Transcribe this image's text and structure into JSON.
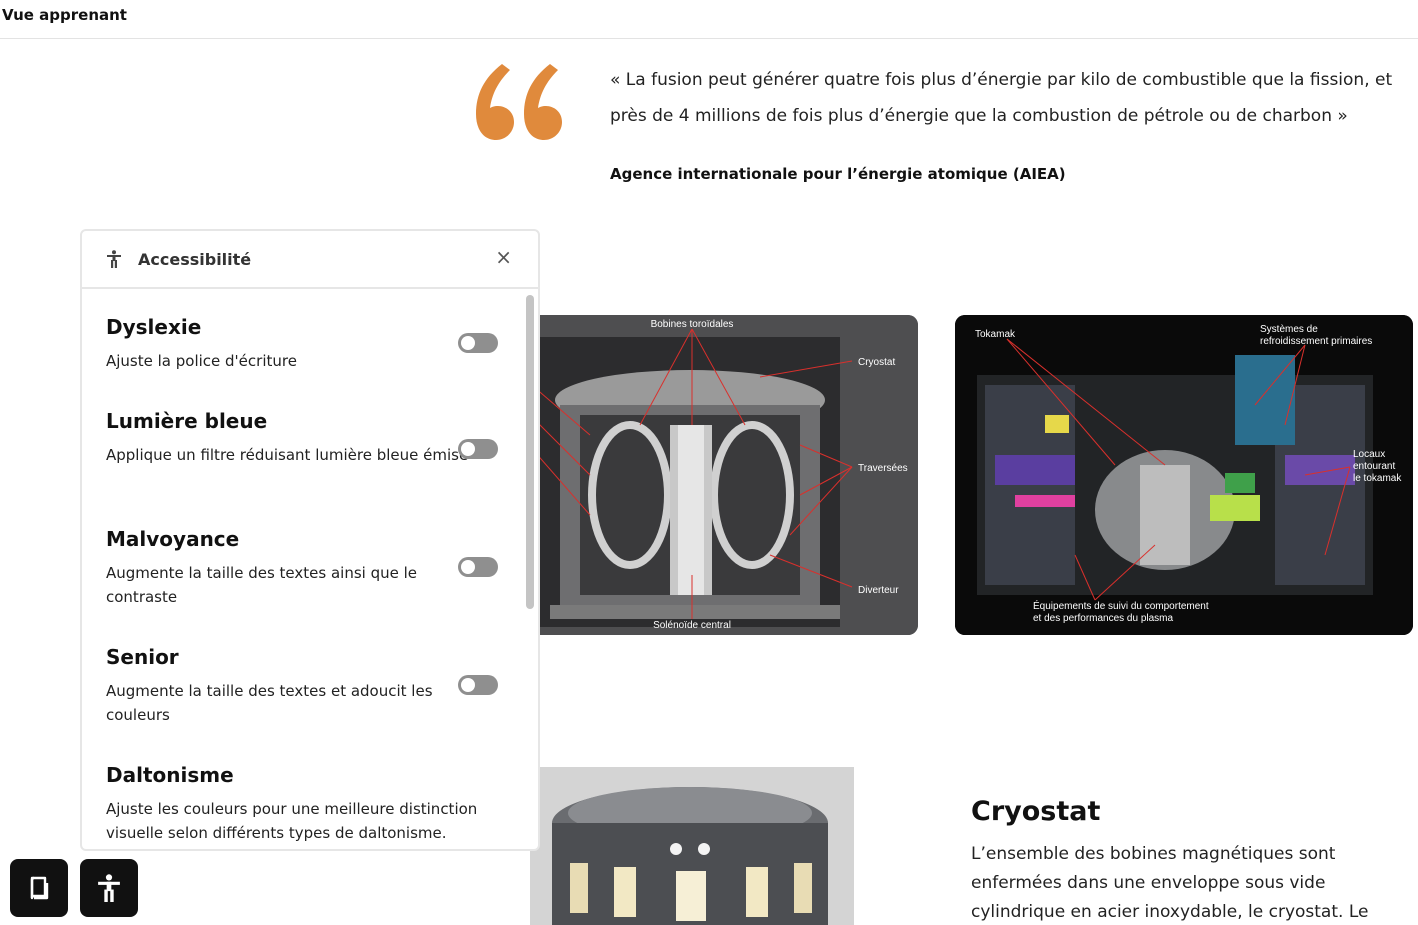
{
  "topbar": {
    "title": "Vue apprenant"
  },
  "quote": {
    "text": "« La fusion peut générer quatre fois plus d’énergie par kilo de combustible que la fission, et près de 4 millions de fois plus d’énergie que la combustion de pétrole ou de charbon »",
    "author": "Agence internationale pour l’énergie atomique (AIEA)",
    "accent_color": "#e08a3c"
  },
  "diagram_left": {
    "labels": {
      "top": "Bobines toroïdales",
      "cryostat": "Cryostat",
      "traversees": "Traversées",
      "diverteur": "Diverteur",
      "bottom": "Solénoïde central"
    }
  },
  "diagram_right": {
    "labels": {
      "tokamak": "Tokamak",
      "systemes_l1": "Systèmes de",
      "systemes_l2": "refroidissement primaires",
      "locaux_l1": "Locaux",
      "locaux_l2": "entourant",
      "locaux_l3": "le tokamak",
      "equip_l1": "Équipements de suivi du comportement",
      "equip_l2": "et des performances du plasma"
    }
  },
  "cryostat": {
    "title": "Cryostat",
    "text": "L’ensemble des bobines magnétiques sont enfermées dans une enveloppe sous vide cylindrique en acier inoxydable, le cryostat. Le"
  },
  "accessibility_panel": {
    "title": "Accessibilité",
    "close_label": "×",
    "options": [
      {
        "title": "Dyslexie",
        "desc": "Ajuste la police d'écriture",
        "enabled": false
      },
      {
        "title": "Lumière bleue",
        "desc": "Applique un filtre réduisant lumière bleue émise",
        "enabled": false
      },
      {
        "title": "Malvoyance",
        "desc": "Augmente la taille des textes ainsi que le contraste",
        "enabled": false
      },
      {
        "title": "Senior",
        "desc": "Augmente la taille des textes et adoucit les couleurs",
        "enabled": false
      },
      {
        "title": "Daltonisme",
        "desc": "Ajuste les couleurs pour une meilleure distinction visuelle selon différents types de daltonisme.",
        "enabled": false
      }
    ]
  },
  "fabs": {
    "book_icon": "book-icon",
    "accessibility_icon": "accessibility-icon"
  }
}
